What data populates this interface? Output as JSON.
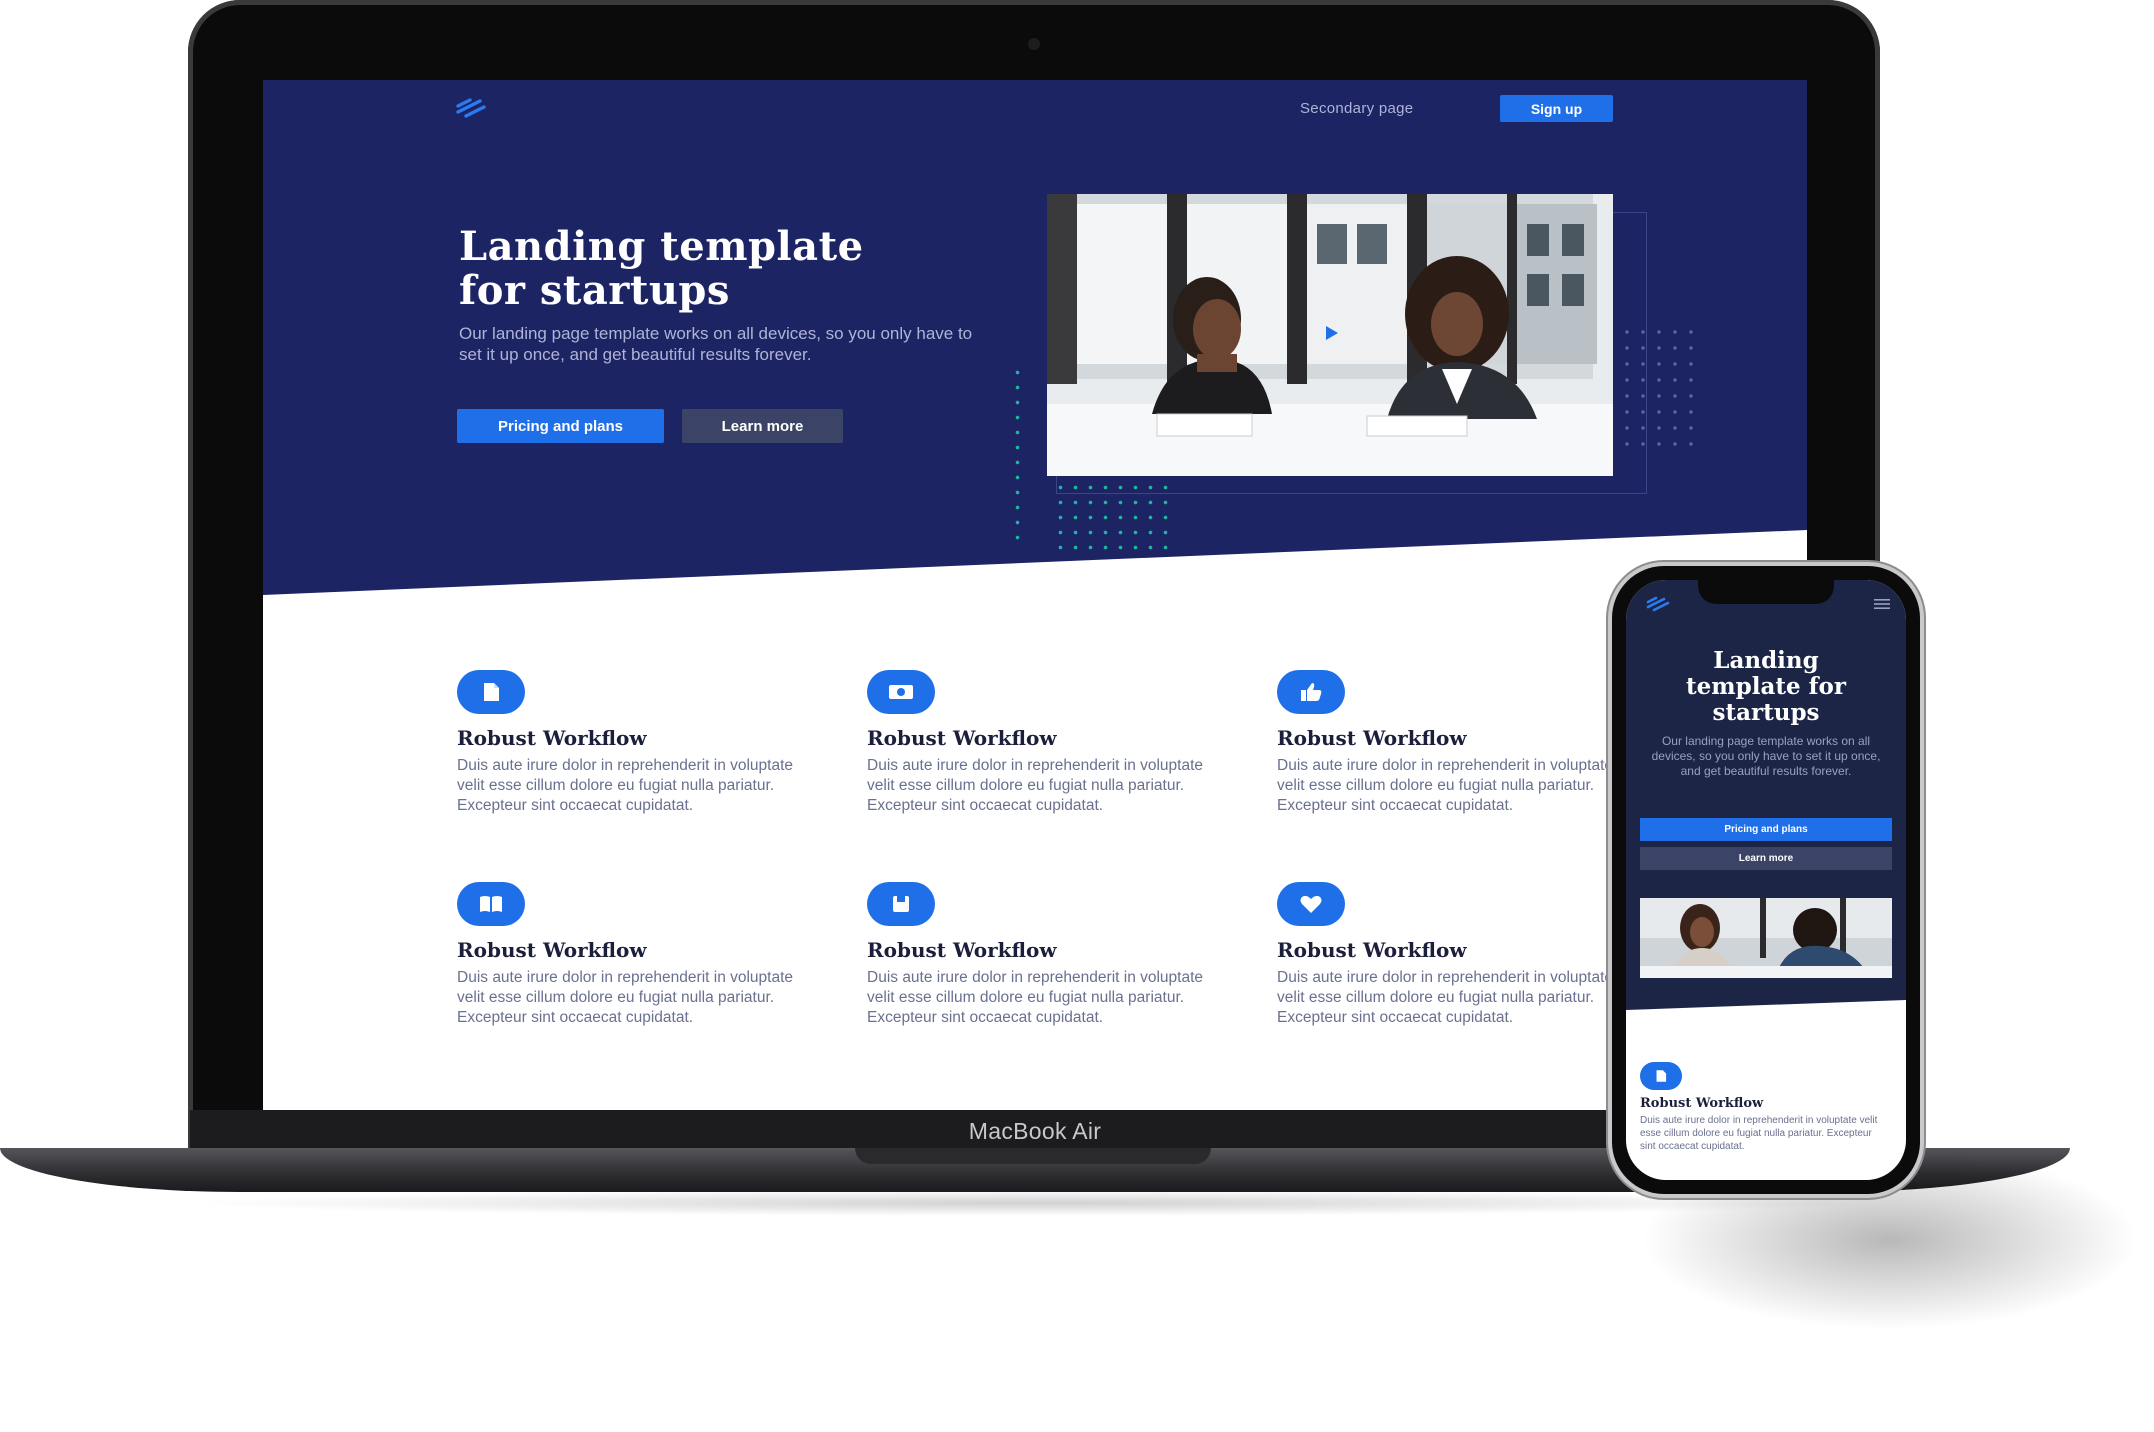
{
  "laptop": {
    "model_label": "MacBook Air"
  },
  "site": {
    "nav": {
      "logo_icon": "stripes-logo-icon",
      "secondary_link": "Secondary page",
      "signup_label": "Sign up"
    },
    "hero": {
      "title_line1": "Landing template",
      "title_line2": "for startups",
      "description": "Our landing page template works on all devices, so you only have to set it up once, and get beautiful results forever.",
      "primary_cta": "Pricing and plans",
      "secondary_cta": "Learn more",
      "media_icon": "play-icon"
    },
    "features": [
      {
        "icon": "document-icon",
        "title": "Robust Workflow",
        "body": "Duis aute irure dolor in reprehenderit in voluptate velit esse cillum dolore eu fugiat nulla pariatur. Excepteur sint occaecat cupidatat."
      },
      {
        "icon": "money-icon",
        "title": "Robust Workflow",
        "body": "Duis aute irure dolor in reprehenderit in voluptate velit esse cillum dolore eu fugiat nulla pariatur. Excepteur sint occaecat cupidatat."
      },
      {
        "icon": "thumbs-up-icon",
        "title": "Robust Workflow",
        "body": "Duis aute irure dolor in reprehenderit in voluptate velit esse cillum dolore eu fugiat nulla pariatur. Excepteur sint occaecat cupidatat."
      },
      {
        "icon": "book-icon",
        "title": "Robust Workflow",
        "body": "Duis aute irure dolor in reprehenderit in voluptate velit esse cillum dolore eu fugiat nulla pariatur. Excepteur sint occaecat cupidatat."
      },
      {
        "icon": "save-icon",
        "title": "Robust Workflow",
        "body": "Duis aute irure dolor in reprehenderit in voluptate velit esse cillum dolore eu fugiat nulla pariatur. Excepteur sint occaecat cupidatat."
      },
      {
        "icon": "heart-icon",
        "title": "Robust Workflow",
        "body": "Duis aute irure dolor in reprehenderit in voluptate velit esse cillum dolore eu fugiat nulla pariatur. Excepteur sint occaecat cupidatat."
      }
    ]
  },
  "phone": {
    "logo_icon": "stripes-logo-icon",
    "menu_icon": "hamburger-menu-icon",
    "title_line1": "Landing",
    "title_line2": "template for",
    "title_line3": "startups",
    "description": "Our landing page template works on all devices, so you only have to set it up once, and get beautiful results forever.",
    "primary_cta": "Pricing and plans",
    "secondary_cta": "Learn more",
    "feature": {
      "icon": "document-icon",
      "title": "Robust Workflow",
      "body": "Duis aute irure dolor in reprehenderit in voluptate velit esse cillum dolore eu fugiat nulla pariatur. Excepteur sint occaecat cupidatat."
    }
  },
  "colors": {
    "hero_bg": "#1d2463",
    "accent": "#1f6fe8",
    "secondary_button": "#3b4466",
    "dot_accent": "#22b5a2"
  }
}
